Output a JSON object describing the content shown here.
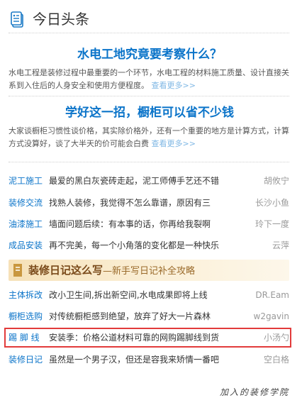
{
  "header": {
    "title": "今日头条",
    "icon": "newspaper-icon"
  },
  "features": [
    {
      "title": "水电工地究竟要考察什么？",
      "desc": "水电工程是装修过程中最重要的一个环节，水电工程的材料施工质量、设计直接关系到入住后的人身安全和使用方便程度。",
      "more": "查看更多>>"
    },
    {
      "title": "学好这一招，橱柜可以省不少钱",
      "desc": "大家谈橱柜习惯性谈价格，其实除价格外，还有一个重要的地方是计算方式，计算方式没算好，谈了大半天的价可能会白费",
      "more": "查看更多>>"
    }
  ],
  "articles_a": [
    {
      "tag": "泥工施工",
      "title": "最爱的黑白灰瓷砖走起，泥工师傅手艺还不错",
      "author": "胡攸宁"
    },
    {
      "tag": "装修交流",
      "title": "找熟人装修，我觉得不怎么靠谱，原因有三",
      "author": "长沙小鱼"
    },
    {
      "tag": "油漆施工",
      "title": "墙面问题后续：有本事的话，你再给我裂啊",
      "author": "玲下一度"
    },
    {
      "tag": "成品安装",
      "title": "再不完美，每一个小角落的变化都是一种快乐",
      "author": "云萍"
    }
  ],
  "banner": {
    "title": "装修日记这么写",
    "subtitle": "—新手写日记补全攻略"
  },
  "articles_b": [
    {
      "tag": "主体拆改",
      "title": "改小卫生间,拆出新空间,水电成果即将上线",
      "author": "DR.Eam"
    },
    {
      "tag": "橱柜选购",
      "title": "对传统橱柜感到绝望，放弃了好大一片森林",
      "author": "w2gavin"
    },
    {
      "tag": "踢 脚 线",
      "title": "安装季：价格公道材料可靠的网购踢脚线到货",
      "author": "小汤勺"
    },
    {
      "tag": "装修日记",
      "title": "虽然是一个男子汉，但还是容我来矫情一番吧",
      "author": "空白格"
    }
  ],
  "footer": {
    "text": "加入的装修学院"
  },
  "colors": {
    "link_blue": "#0b74c9",
    "highlight_red": "#e23b3b",
    "banner_bg": "#f6e1b8"
  }
}
